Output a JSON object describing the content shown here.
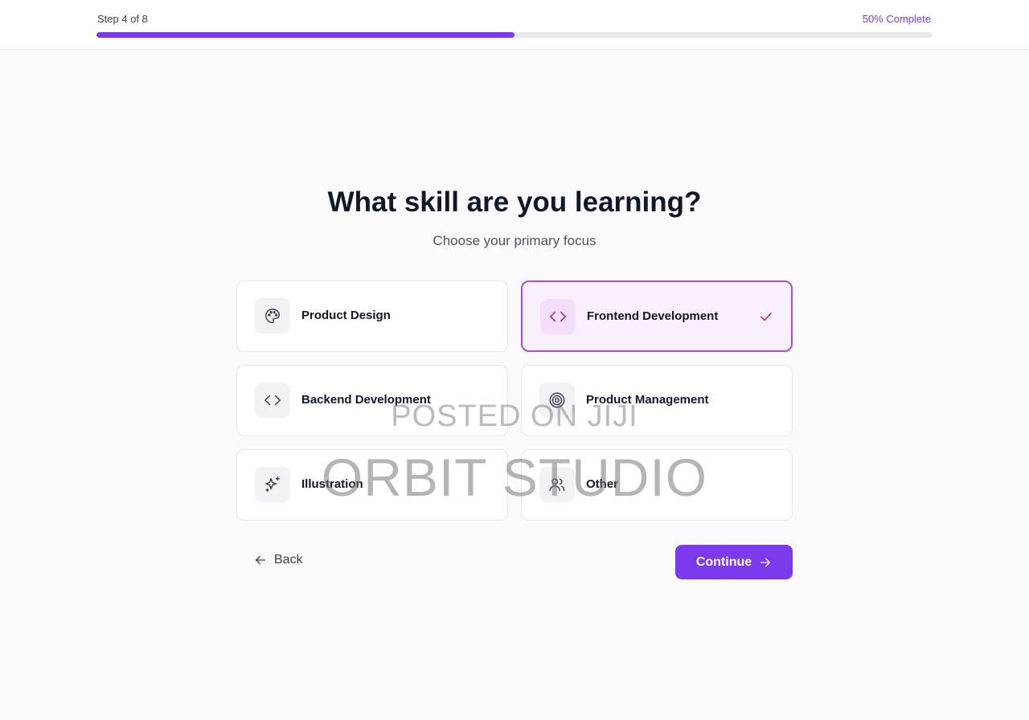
{
  "header": {
    "step_text": "Step 4 of 8",
    "complete_text": "50% Complete",
    "progress_fraction": 0.5
  },
  "question": {
    "title": "What skill are you learning?",
    "subtitle": "Choose your primary focus"
  },
  "options": [
    {
      "label": "Product Design",
      "icon": "palette-icon",
      "selected": false
    },
    {
      "label": "Frontend Development",
      "icon": "code-icon",
      "selected": true
    },
    {
      "label": "Backend Development",
      "icon": "code-icon",
      "selected": false
    },
    {
      "label": "Product Management",
      "icon": "target-icon",
      "selected": false
    },
    {
      "label": "Illustration",
      "icon": "sparkles-icon",
      "selected": false
    },
    {
      "label": "Other",
      "icon": "users-icon",
      "selected": false
    }
  ],
  "actions": {
    "back_label": "Back",
    "continue_label": "Continue"
  },
  "watermark": {
    "line1": "POSTED ON JIJI",
    "line2": "ORBIT STUDIO"
  },
  "colors": {
    "accent": "#7c3aed",
    "selected_border": "#b34ad6",
    "selected_bg": "#faf0fd"
  }
}
